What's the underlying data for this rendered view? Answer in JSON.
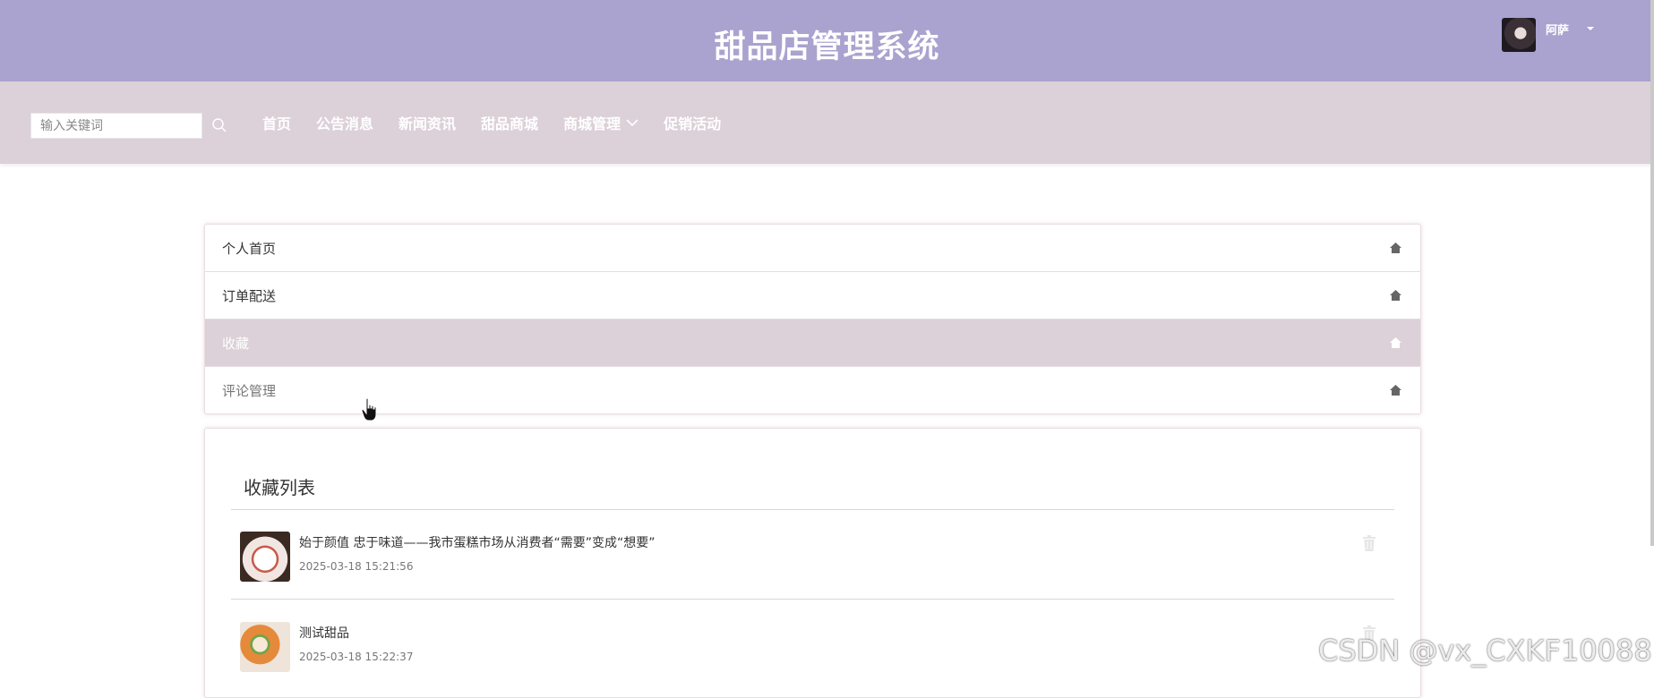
{
  "header": {
    "site_title": "甜品店管理系统",
    "user": {
      "name": "阿萨",
      "avatar_icon": "avatar-photo",
      "dropdown_icon": "caret-down-icon"
    }
  },
  "nav": {
    "search": {
      "placeholder": "输入关键词",
      "value": "",
      "icon": "search-icon"
    },
    "items": [
      {
        "label": "首页"
      },
      {
        "label": "公告消息"
      },
      {
        "label": "新闻资讯"
      },
      {
        "label": "甜品商城"
      },
      {
        "label": "商城管理",
        "has_dropdown": true
      },
      {
        "label": "促销活动"
      }
    ]
  },
  "side_menu": {
    "items": [
      {
        "label": "个人首页",
        "icon": "home-icon",
        "active": false
      },
      {
        "label": "订单配送",
        "icon": "home-icon",
        "active": false
      },
      {
        "label": "收藏",
        "icon": "home-icon",
        "active": true
      },
      {
        "label": "评论管理",
        "icon": "home-icon",
        "active": false
      }
    ]
  },
  "favorites": {
    "title": "收藏列表",
    "items": [
      {
        "title": "始于颜值 忠于味道——我市蛋糕市场从消费者“需要”变成“想要”",
        "date": "2025-03-18 15:21:56",
        "thumb": "cake-photo",
        "action_icon": "trash-icon"
      },
      {
        "title": "测试甜品",
        "date": "2025-03-18 15:22:37",
        "thumb": "cake-roll-photo",
        "action_icon": "trash-icon"
      }
    ]
  },
  "watermark": "CSDN @vx_CXKF10088",
  "colors": {
    "header_bg": "#aaa2cf",
    "navbar_bg": "#dcd0d9",
    "active_menu_bg": "#dcd0d9",
    "text_primary": "#333333",
    "text_muted": "#777777"
  }
}
